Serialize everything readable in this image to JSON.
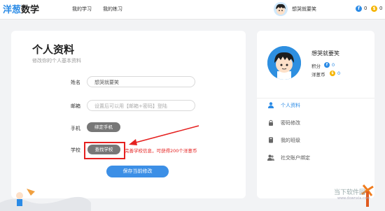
{
  "header": {
    "logo_part1": "洋葱",
    "logo_part2": "数学",
    "nav": [
      "我的学习",
      "我的练习"
    ],
    "username": "想哭就要笑",
    "coin_blue_value": "0",
    "coin_gold_value": "0"
  },
  "profile_form": {
    "title": "个人资料",
    "subtitle": "修改你的个人基本资料",
    "name_label": "姓名",
    "name_value": "想哭就要笑",
    "email_label": "邮箱",
    "email_placeholder": "设置后可以用【邮箱+密码】登陆",
    "phone_label": "手机",
    "phone_button": "绑定手机",
    "school_label": "学校",
    "school_button": "查找学校",
    "school_hint": "完善学校信息，可获得200个洋葱币",
    "save_button": "保存当前修改"
  },
  "sidebar": {
    "name": "想哭就要笑",
    "points_label": "积分",
    "points_value": "0",
    "coins_label": "洋葱币",
    "coins_value": "0",
    "menu": [
      {
        "label": "个人资料",
        "icon": "person-icon",
        "active": true
      },
      {
        "label": "密码修改",
        "icon": "lock-icon",
        "active": false
      },
      {
        "label": "我的班级",
        "icon": "class-icon",
        "active": false
      },
      {
        "label": "社交账户绑定",
        "icon": "people-icon",
        "active": false
      }
    ]
  },
  "watermark": {
    "text": "当下软件园",
    "sub": "www.downxia.com"
  },
  "colors": {
    "accent": "#2b8be6",
    "highlight": "#e5201f",
    "button_gray": "#777777",
    "gold_coin": "#f5b400"
  }
}
